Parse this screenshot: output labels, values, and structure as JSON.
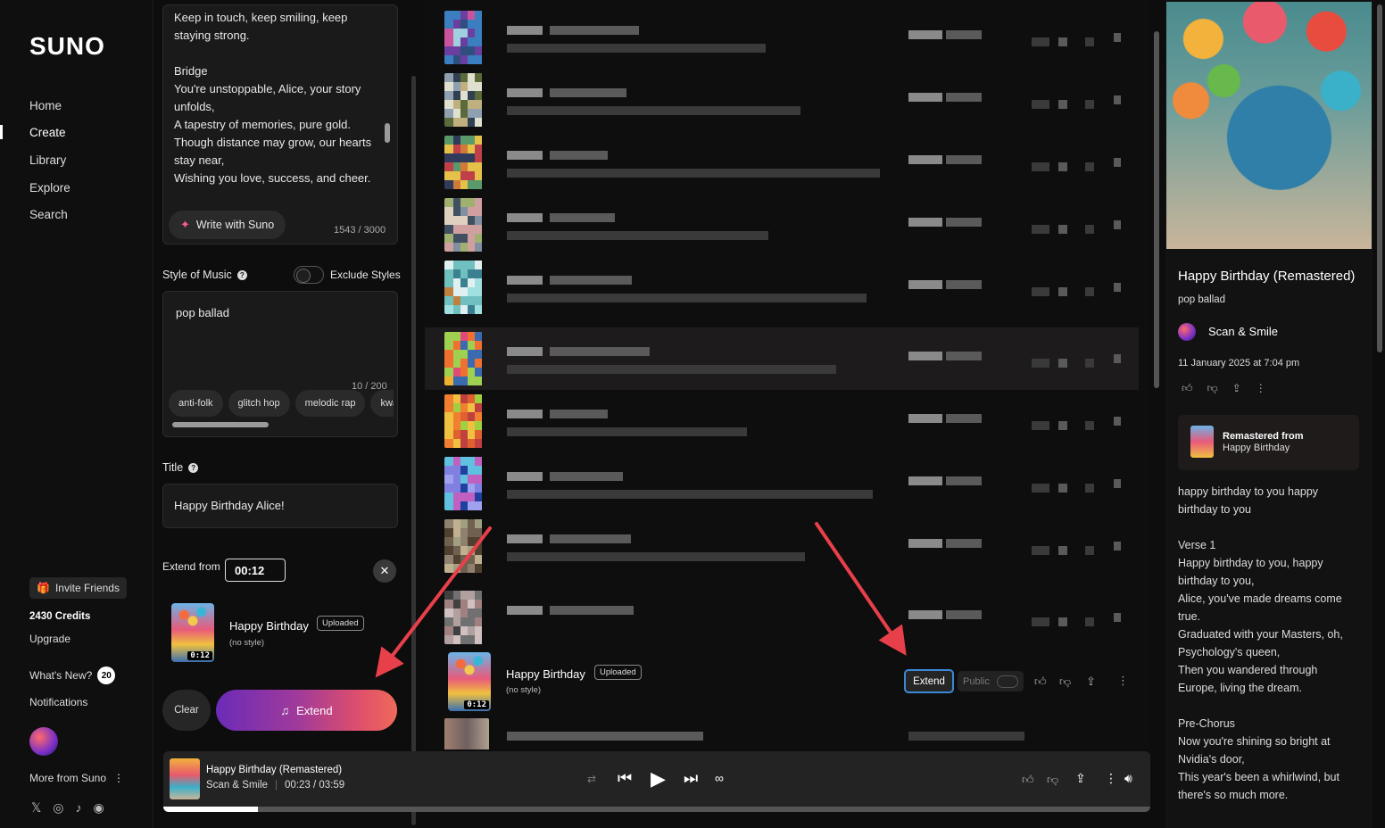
{
  "nav": {
    "logo": "SUNO",
    "items": [
      "Home",
      "Create",
      "Library",
      "Explore",
      "Search"
    ],
    "invite": "Invite Friends",
    "credits": "2430 Credits",
    "upgrade": "Upgrade",
    "whats_new": "What's New?",
    "whats_new_count": "20",
    "notifications": "Notifications",
    "more_from": "More from Suno"
  },
  "create": {
    "lyrics": "Keep in touch, keep smiling, keep\nstaying strong.\n\nBridge\nYou're unstoppable, Alice, your story\nunfolds,\nA tapestry of memories, pure gold.\nThough distance may grow, our hearts\nstay near,\nWishing you love, success, and cheer.",
    "write_with_suno": "Write with Suno",
    "lyrics_counter": "1543 / 3000",
    "style_label": "Style of Music",
    "exclude_styles": "Exclude Styles",
    "style_value": "pop ballad",
    "style_counter": "10 / 200",
    "style_chips": [
      "anti-folk",
      "glitch hop",
      "melodic rap",
      "kwa"
    ],
    "title_label": "Title",
    "title_value": "Happy Birthday Alice!",
    "extend_from_label": "Extend from",
    "extend_from_value": "00:12",
    "clip": {
      "title": "Happy Birthday",
      "badge": "Uploaded",
      "style": "(no style)",
      "duration": "0:12"
    },
    "clear": "Clear",
    "extend": "Extend"
  },
  "list": {
    "active_clip": {
      "title": "Happy Birthday",
      "badge": "Uploaded",
      "style": "(no style)",
      "duration": "0:12"
    },
    "extend_button": "Extend",
    "public_label": "Public"
  },
  "detail": {
    "title": "Happy Birthday (Remastered)",
    "style": "pop ballad",
    "artist": "Scan & Smile",
    "date": "11 January 2025 at 7:04 pm",
    "remastered_from_label": "Remastered from",
    "remastered_from_title": "Happy Birthday",
    "lyrics": "happy birthday to you happy\nbirthday to you\n\nVerse 1\nHappy birthday to you, happy\nbirthday to you,\nAlice, you've made dreams come\ntrue.\nGraduated with your Masters, oh,\nPsychology's queen,\nThen you wandered through\nEurope, living the dream.\n\nPre-Chorus\nNow you're shining so bright at\nNvidia's door,\nThis year's been a whirlwind, but\nthere's so much more."
  },
  "player": {
    "title": "Happy Birthday (Remastered)",
    "artist": "Scan & Smile",
    "time": "00:23 / 03:59",
    "progress": 0.096
  },
  "colors": {
    "accent_blue": "#3b88d9",
    "extend_gradient_start": "#6b2bb8",
    "extend_gradient_end": "#ef6a5a",
    "arrow_red": "#e8404a"
  }
}
